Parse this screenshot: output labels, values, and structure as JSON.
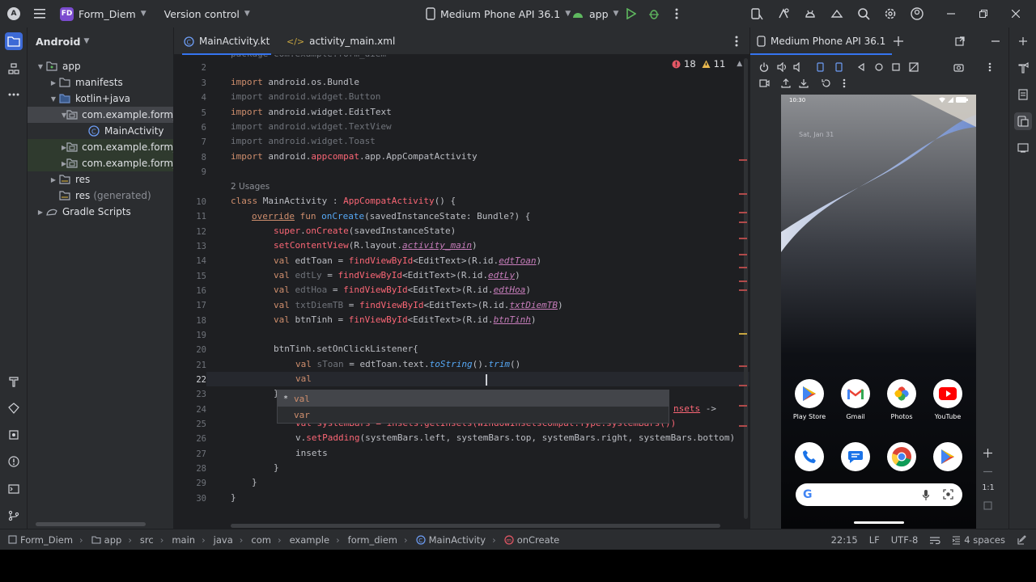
{
  "titlebar": {
    "project_badge": "FD",
    "project_name": "Form_Diem",
    "vcs": "Version control",
    "device": "Medium Phone API 36.1",
    "run_config": "app"
  },
  "project_panel": {
    "title": "Android",
    "tree": [
      {
        "label": "app",
        "suffix": ""
      },
      {
        "label": "manifests",
        "suffix": ""
      },
      {
        "label": "kotlin+java",
        "suffix": ""
      },
      {
        "label": "com.example.form_d",
        "suffix": ""
      },
      {
        "label": "MainActivity",
        "suffix": ""
      },
      {
        "label": "com.example.form_d",
        "suffix": ""
      },
      {
        "label": "com.example.form_d",
        "suffix": ""
      },
      {
        "label": "res",
        "suffix": ""
      },
      {
        "label": "res",
        "suffix": "(generated)"
      },
      {
        "label": "Gradle Scripts",
        "suffix": ""
      }
    ]
  },
  "editor": {
    "tabs": [
      "MainActivity.kt",
      "activity_main.xml"
    ],
    "errors": "18",
    "warnings": "11",
    "line_numbers": [
      "2",
      "3",
      "4",
      "5",
      "6",
      "7",
      "8",
      "9",
      "10",
      "11",
      "12",
      "13",
      "14",
      "15",
      "16",
      "17",
      "18",
      "19",
      "20",
      "21",
      "22",
      "23",
      "24",
      "25",
      "26",
      "27",
      "28",
      "29",
      "30"
    ],
    "usages_hint": "2 Usages",
    "lines": {
      "l2": "package com.example.form_diem",
      "l3a": "import",
      "l3b": " android.os.Bundle",
      "l4": "import android.widget.Button",
      "l5a": "import",
      "l5b": " android.widget.EditText",
      "l6": "import android.widget.TextView",
      "l7": "import android.widget.Toast",
      "l8a": "import",
      "l8b": " android.",
      "l8c": "appcompat",
      "l8d": ".app.AppCompatActivity",
      "l10a": "class",
      "l10b": " MainActivity : ",
      "l10c": "AppCompatActivity",
      "l10d": "() {",
      "l11a": "override",
      "l11b": " fun ",
      "l11c": "onCreate",
      "l11d": "(savedInstanceState: Bundle?) {",
      "l12a": "super",
      "l12b": ".",
      "l12c": "onCreate",
      "l12d": "(savedInstanceState)",
      "l13a": "setContentView",
      "l13b": "(R.layout.",
      "l13c": "activity_main",
      "l13d": ")",
      "l14a": "val",
      "l14b": " edtToan = ",
      "l14c": "findViewById",
      "l14d": "<EditText>(R.id.",
      "l14e": "edtToan",
      "l14f": ")",
      "l15a": "val",
      "l15b": " edtLy",
      "l15c": " = ",
      "l15d": "findViewById",
      "l15e": "<EditText>(R.id.",
      "l15f": "edtLy",
      "l15g": ")",
      "l16a": "val",
      "l16b": " edtHoa",
      "l16c": " = ",
      "l16d": "findViewById",
      "l16e": "<EditText>(R.id.",
      "l16f": "edtHoa",
      "l16g": ")",
      "l17a": "val",
      "l17b": " txtDiemTB",
      "l17c": " = ",
      "l17d": "findViewById",
      "l17e": "<EditText>(R.id.",
      "l17f": "txtDiemTB",
      "l17g": ")",
      "l18a": "val",
      "l18b": " btnTinh = ",
      "l18c": "finViewById",
      "l18d": "<EditText>(R.id.",
      "l18e": "btnTinh",
      "l18f": ")",
      "l20": "btnTinh.setOnClickListener{",
      "l21a": "val",
      "l21b": " sToan",
      "l21c": " = edtToan.text.",
      "l21d": "toString",
      "l21e": "().",
      "l21f": "trim",
      "l21g": "()",
      "l22": "val",
      "l23": "}",
      "l24": "setOnApplyWindowInsetsListener(findViewById(R.id.main)) { v, insets ->",
      "l24_tail": "nsets",
      "l24_arrow": " ->",
      "l25": "val systemBars = insets.getInsets(WindowInsetsCompat.Type.systemBars())",
      "l26a": "v.",
      "l26b": "setPadding",
      "l26c": "(systemBars.left, systemBars.top, systemBars.right, systemBars.bottom)",
      "l27": "insets",
      "l28": "}",
      "l29": "}",
      "l30": "}"
    },
    "completion": [
      "val",
      "var"
    ]
  },
  "device_panel": {
    "tab": "Medium Phone API 36.1",
    "phone": {
      "time": "10:30",
      "date": "Sat, Jan 31",
      "apps": [
        "Play Store",
        "Gmail",
        "Photos",
        "YouTube"
      ]
    },
    "zoom_label": "1:1"
  },
  "statusbar": {
    "breadcrumbs": [
      "Form_Diem",
      "app",
      "src",
      "main",
      "java",
      "com",
      "example",
      "form_diem",
      "MainActivity",
      "onCreate"
    ],
    "position": "22:15",
    "line_sep": "LF",
    "encoding": "UTF-8",
    "indent": "4 spaces"
  }
}
